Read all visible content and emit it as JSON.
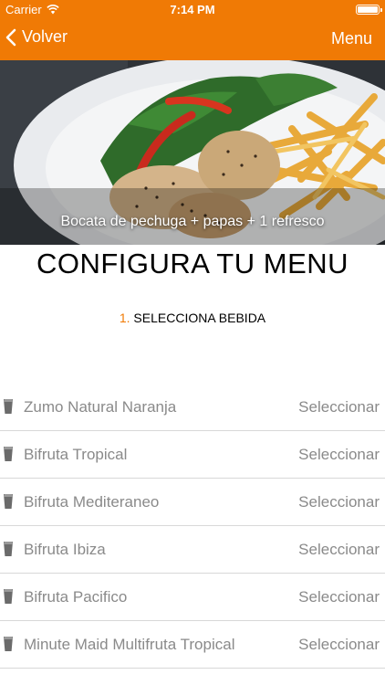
{
  "status": {
    "carrier": "Carrier",
    "time": "7:14 PM",
    "wifi_icon": "wifi-icon",
    "battery_icon": "battery-icon"
  },
  "nav": {
    "back_label": "Volver",
    "back_icon": "chevron-left-icon",
    "menu_label": "Menu"
  },
  "hero": {
    "caption": "Bocata de pechuga + papas + 1 refresco"
  },
  "page": {
    "title": "CONFIGURA TU MENU",
    "step_number": "1.",
    "step_label": "SELECCIONA BEBIDA"
  },
  "colors": {
    "accent": "#f07a05",
    "item_text": "#8a8a8a",
    "divider": "#d8d8d8"
  },
  "drinks": [
    {
      "name": "Zumo Natural Naranja",
      "action": "Seleccionar",
      "icon": "glass-icon"
    },
    {
      "name": "Bifruta Tropical",
      "action": "Seleccionar",
      "icon": "glass-icon"
    },
    {
      "name": "Bifruta Mediteraneo",
      "action": "Seleccionar",
      "icon": "glass-icon"
    },
    {
      "name": "Bifruta Ibiza",
      "action": "Seleccionar",
      "icon": "glass-icon"
    },
    {
      "name": "Bifruta Pacifico",
      "action": "Seleccionar",
      "icon": "glass-icon"
    },
    {
      "name": "Minute Maid Multifruta Tropical",
      "action": "Seleccionar",
      "icon": "glass-icon"
    }
  ]
}
